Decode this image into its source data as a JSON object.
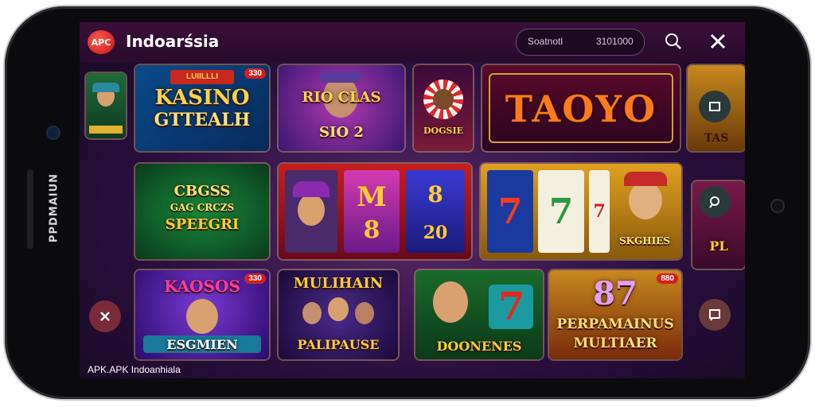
{
  "header": {
    "logo_text": "APC",
    "title": "Indoarśsia",
    "search_placeholder": "Soatnotl",
    "search_value": "3101000",
    "search_icon": "search-icon",
    "close_icon": "close-x-icon"
  },
  "device": {
    "side_label": "PPDMAIUN"
  },
  "tiles": {
    "t1": {
      "title": "KASINO",
      "subtitle": "GTTEALH",
      "banner": "LUIILLLI",
      "badge": "330"
    },
    "t2": {
      "title": "RIO CLAS",
      "subtitle": "SIO 2"
    },
    "t3": {
      "label": "DOGSIE"
    },
    "t4": {
      "title": "TAOYO"
    },
    "t5": {
      "label": "TAS"
    },
    "t6": {
      "title": "CBGSS",
      "line2": "GAG CRCZS",
      "subtitle": "SPEEGRI"
    },
    "t7": {
      "reel_a": "M",
      "reel_b": "8",
      "reel_c": "8",
      "reel_d": "20"
    },
    "t8": {
      "reel_a": "7",
      "reel_b": "7",
      "reel_c": "7",
      "label": "SKGHIES"
    },
    "t9": {
      "title": "KAOSOS",
      "subtitle": "ESGMIEN",
      "badge": "330"
    },
    "t10": {
      "title": "MULIHAIN",
      "subtitle": "PALIPAUSE"
    },
    "t11": {
      "title": "DOONENES",
      "reel": "7"
    },
    "t12": {
      "number": "87",
      "title": "PERPAMAINUS",
      "subtitle": "MULTIAER",
      "badge": "880"
    },
    "t13": {
      "label": "PL"
    }
  },
  "side_buttons": {
    "square_icon": "square-icon",
    "map_icon": "location-icon",
    "chat_icon": "chat-icon",
    "close_icon": "close-icon"
  },
  "footer": {
    "text": "APK.APK Indoanhiala"
  },
  "colors": {
    "accent": "#d4201e",
    "gold": "#ffcc33",
    "bg": "#2a0f2e"
  }
}
